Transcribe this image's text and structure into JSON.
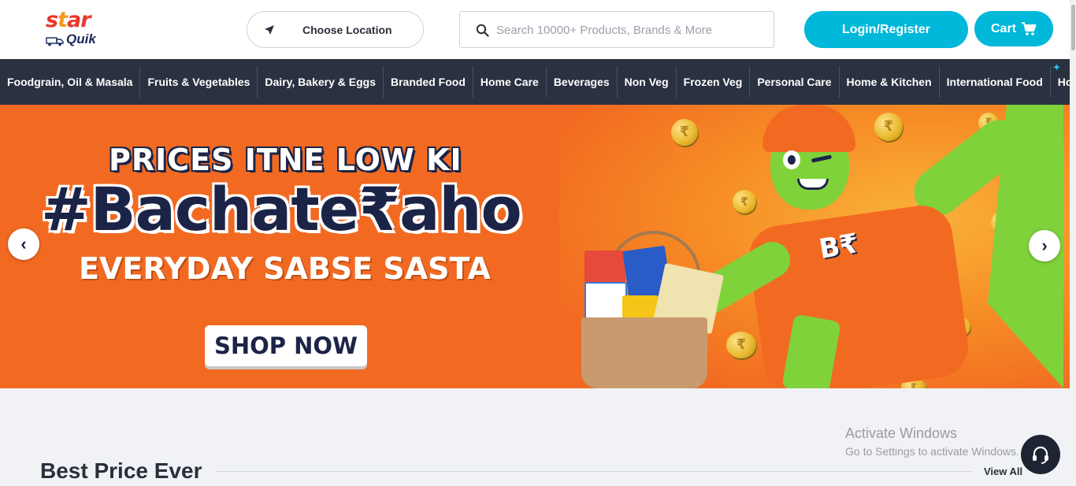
{
  "header": {
    "logo": {
      "top": "star",
      "bottom": "Quik"
    },
    "location_label": "Choose Location",
    "search": {
      "placeholder": "Search 10000+ Products, Brands & More",
      "value": ""
    },
    "login_label": "Login/Register",
    "cart_label": "Cart"
  },
  "nav": {
    "items": [
      "Foodgrain, Oil & Masala",
      "Fruits & Vegetables",
      "Dairy, Bakery & Eggs",
      "Branded Food",
      "Home Care",
      "Beverages",
      "Non Veg",
      "Frozen Veg",
      "Personal Care",
      "Home & Kitchen",
      "International Food",
      "Hot Offers"
    ]
  },
  "banner": {
    "headline_top": "PRICES ITNE LOW KI",
    "headline_main": "#Bachate₹aho",
    "headline_sub": "EVERYDAY SABSE SASTA",
    "cta_label": "SHOP NOW",
    "mascot_logo": "B₹",
    "prev_label": "‹",
    "next_label": "›"
  },
  "section": {
    "title": "Best Price Ever",
    "view_all": "View All"
  },
  "watermark": {
    "line1": "Activate Windows",
    "line2": "Go to Settings to activate Windows."
  },
  "colors": {
    "accent": "#00b8d9",
    "nav_bg": "#2a3140",
    "banner_orange": "#f26a22",
    "dark_text": "#1b2447"
  }
}
